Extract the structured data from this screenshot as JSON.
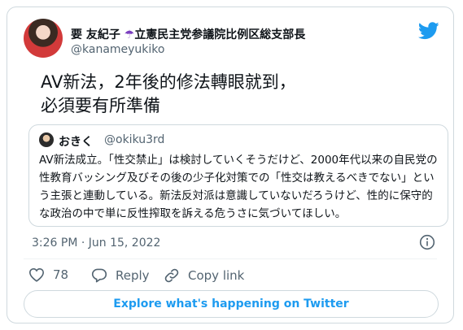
{
  "author": {
    "name": "要 友紀子",
    "title_badge": "☂",
    "title": "立憲民主党参議院比例区総支部長",
    "handle": "@kanameyukiko"
  },
  "tweet": {
    "text": "AV新法，2年後的修法轉眼就到，\n必須要有所準備"
  },
  "quoted_tweet": {
    "name": "おきく",
    "handle": "@okiku3rd",
    "text": "AV新法成立。「性交禁止」は検討していくそうだけど、2000年代以来の自民党の性教育バッシング及びその後の少子化対策での「性交は教えるべきでない」という主張と連動している。新法反対派は意識していないだろうけど、性的に保守的な政治の中で単に反性搾取を訴える危うさに気づいてほしい。"
  },
  "timestamp": "3:26 PM · Jun 15, 2022",
  "actions": {
    "like_count": "78",
    "reply_label": "Reply",
    "copy_link_label": "Copy link"
  },
  "explore_label": "Explore what's happening on Twitter",
  "icons": {
    "logo": "twitter-bird-icon",
    "info": "info-icon",
    "like": "heart-icon",
    "reply": "reply-bubble-icon",
    "copy": "link-icon"
  },
  "colors": {
    "accent": "#1d9bf0",
    "secondary_text": "#536471",
    "border": "#cfd9de",
    "badge": "#7b3fbf"
  }
}
